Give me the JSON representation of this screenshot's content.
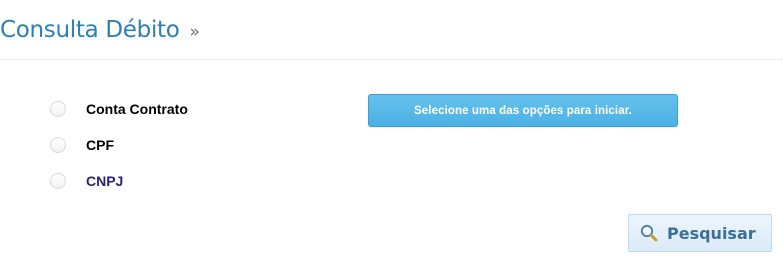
{
  "header": {
    "title": "Consulta Débito",
    "chevron": "»"
  },
  "options": [
    {
      "label": "Conta Contrato",
      "selected": false
    },
    {
      "label": "CPF",
      "selected": false
    },
    {
      "label": "CNPJ",
      "selected": false
    }
  ],
  "info": {
    "message": "Selecione uma das opções para iniciar."
  },
  "actions": {
    "search_label": "Pesquisar",
    "search_icon": "magnifier-icon"
  },
  "colors": {
    "title": "#2e7fb6",
    "info_background": "#55b6e6",
    "button_text": "#3a6f97"
  }
}
